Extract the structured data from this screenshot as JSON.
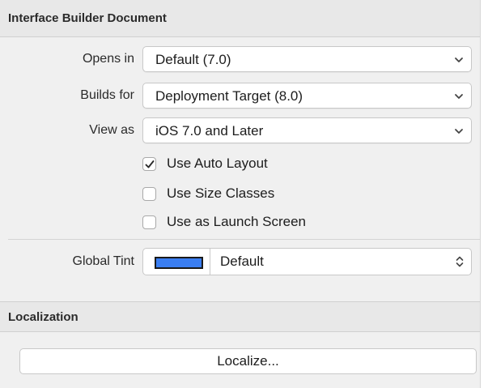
{
  "interface_builder": {
    "title": "Interface Builder Document",
    "opens_in": {
      "label": "Opens in",
      "value": "Default (7.0)"
    },
    "builds_for": {
      "label": "Builds for",
      "value": "Deployment Target (8.0)"
    },
    "view_as": {
      "label": "View as",
      "value": "iOS 7.0 and Later"
    },
    "checkboxes": [
      {
        "label": "Use Auto Layout",
        "checked": true
      },
      {
        "label": "Use Size Classes",
        "checked": false
      },
      {
        "label": "Use as Launch Screen",
        "checked": false
      }
    ],
    "global_tint": {
      "label": "Global Tint",
      "value": "Default",
      "swatch_color": "#3a7ef2"
    }
  },
  "localization": {
    "title": "Localization",
    "button_label": "Localize..."
  },
  "icons": {
    "popup_indicator": "chevron-down-icon",
    "stepper_indicator": "up-down-chevron-icon",
    "checkmark": "checkmark-icon"
  }
}
